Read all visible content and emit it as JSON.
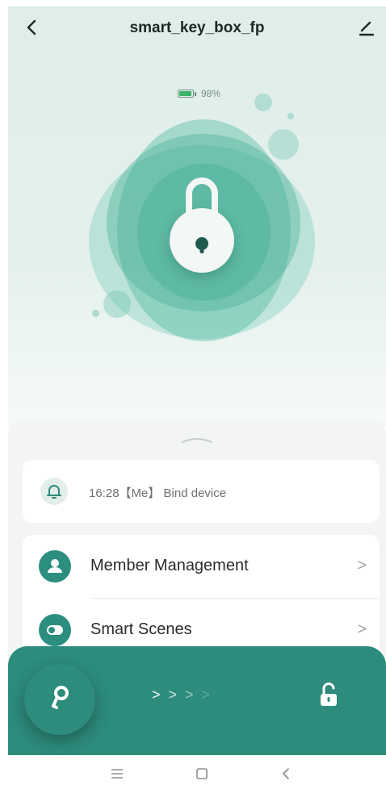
{
  "header": {
    "title": "smart_key_box_fp"
  },
  "battery": {
    "level_text": "98%",
    "level_fraction": 0.98,
    "fill_color": "#39b36a"
  },
  "lock": {
    "icon": "padlock-icon",
    "state": "locked"
  },
  "activity": {
    "text": "16:28【Me】 Bind device",
    "icon": "bell-icon"
  },
  "menu": {
    "items": [
      {
        "label": "Member Management",
        "icon": "person-icon"
      },
      {
        "label": "Smart Scenes",
        "icon": "toggle-icon"
      }
    ]
  },
  "unlock_bar": {
    "slide_arrows": "> > > >",
    "key_icon": "key-icon",
    "target_icon": "unlocked-padlock-icon",
    "color": "#2d8c7c"
  },
  "system_nav": {
    "icons": [
      "menu-icon",
      "home-icon",
      "back-icon"
    ]
  },
  "colors": {
    "accent": "#2d8c7c",
    "hero_bg": "#dfeeea"
  }
}
